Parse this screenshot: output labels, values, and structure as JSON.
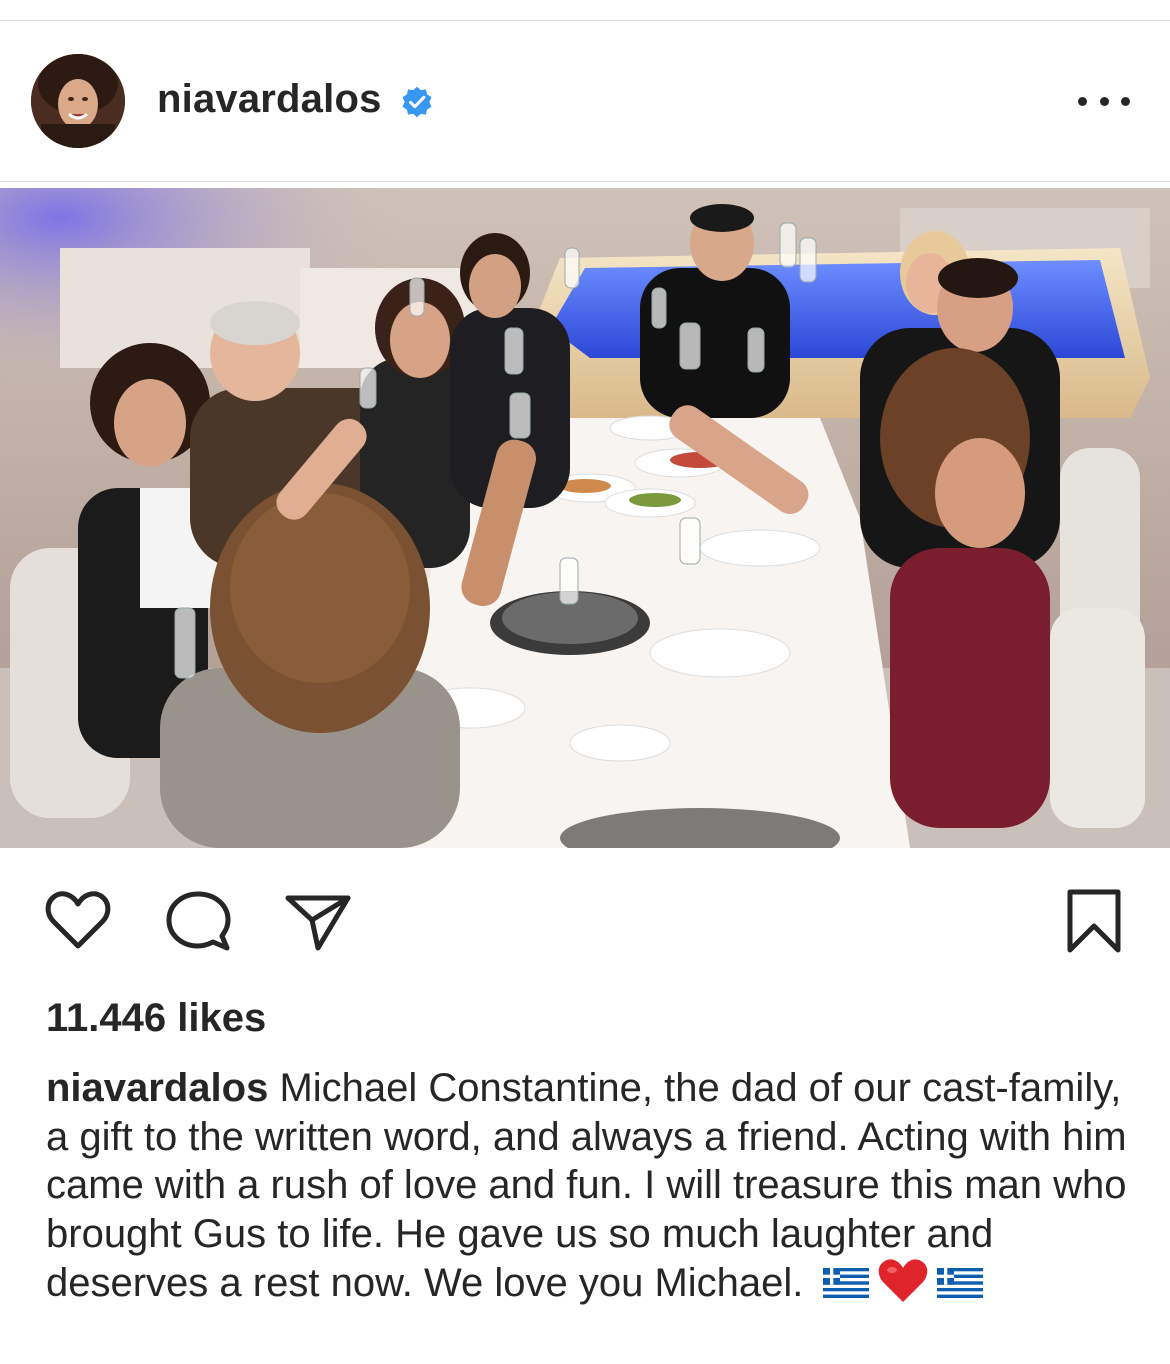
{
  "post": {
    "username": "niavardalos",
    "verified": true,
    "likes_text": "11.446 likes",
    "caption": {
      "username": "niavardalos",
      "text": "Michael Constantine, the dad of our cast-family, a gift to the written word, and always a friend. Acting with him came with a rush of love and fun. I will treasure this man who brought Gus to life. He gave us so much laughter and deserves a rest now. We love you Michael.",
      "emojis": [
        "greek-flag",
        "red-heart",
        "greek-flag"
      ]
    }
  },
  "icons": {
    "more": "more-options-icon",
    "verified": "verified-badge-icon",
    "like": "heart-icon",
    "comment": "comment-bubble-icon",
    "share": "paper-plane-icon",
    "save": "bookmark-icon"
  },
  "colors": {
    "text": "#262626",
    "verified_blue": "#3897f0",
    "divider": "#dbdbdb",
    "greek_blue": "#0d5eaf"
  }
}
